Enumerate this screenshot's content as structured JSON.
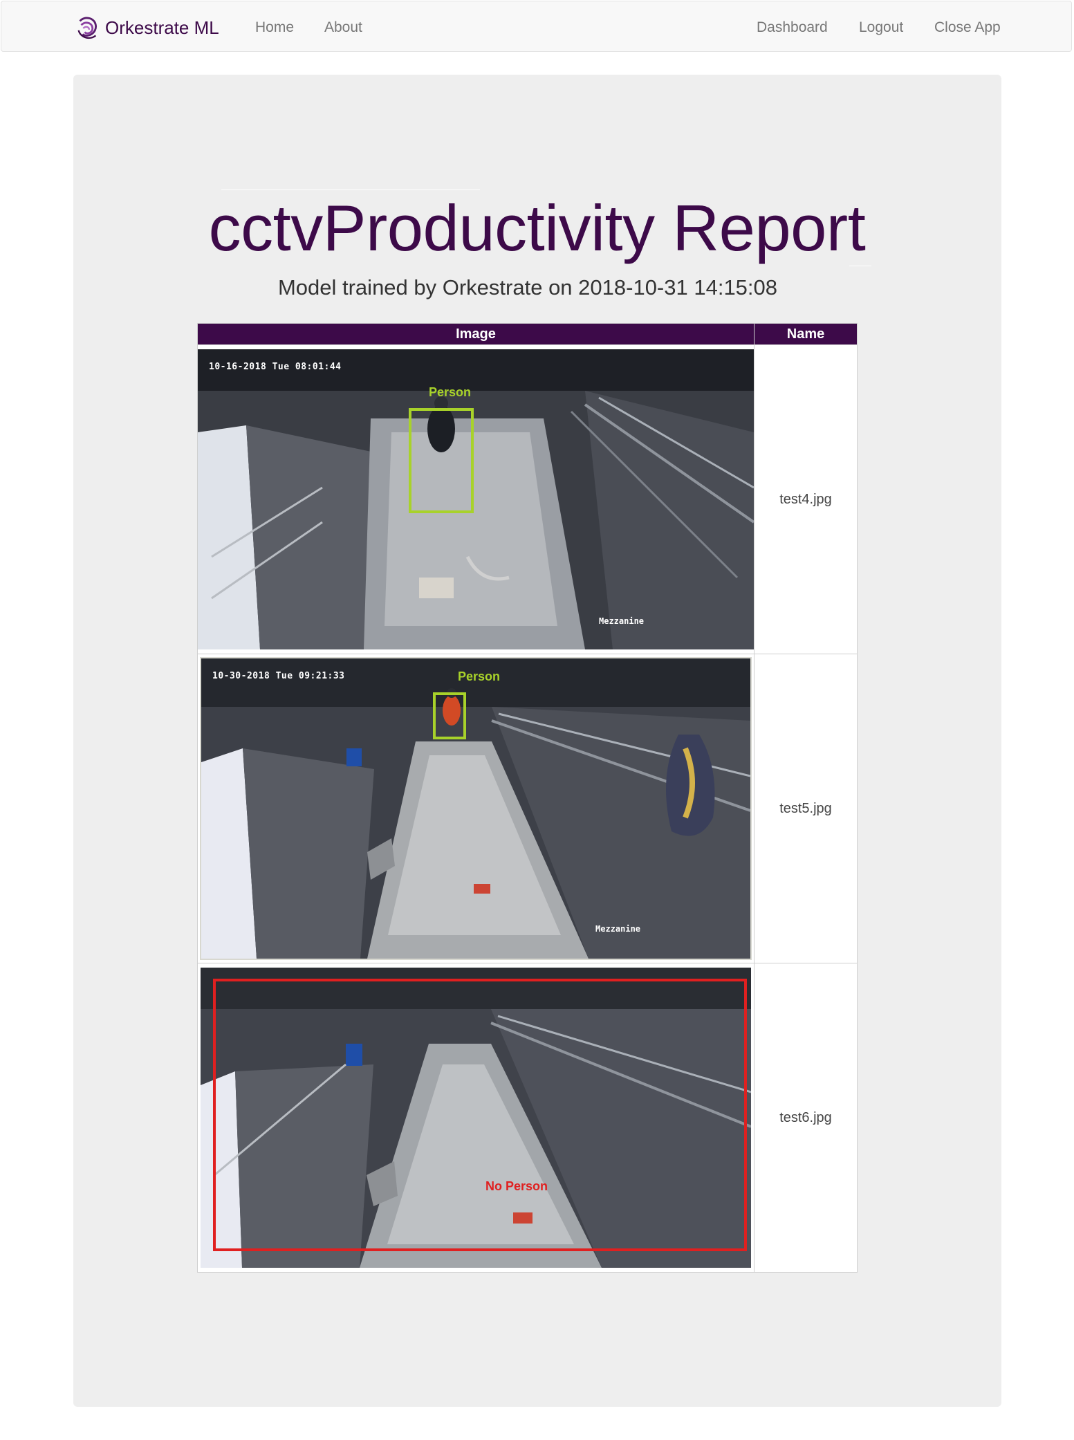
{
  "navbar": {
    "brand": "Orkestrate ML",
    "left_links": [
      "Home",
      "About"
    ],
    "right_links": [
      "Dashboard",
      "Logout",
      "Close App"
    ],
    "logo_icon": "orkestrate-swirl-logo"
  },
  "report": {
    "title": "cctvProductivity Report",
    "subtitle": "Model trained by Orkestrate on 2018-10-31 14:15:08"
  },
  "table": {
    "headers": [
      "Image",
      "Name"
    ],
    "rows": [
      {
        "name": "test4.jpg",
        "timestamp": "10-16-2018 Tue 08:01:44",
        "camera_label": "Mezzanine",
        "detection_label": "Person",
        "detection_color": "#a8d22a"
      },
      {
        "name": "test5.jpg",
        "timestamp": "10-30-2018 Tue 09:21:33",
        "camera_label": "Mezzanine",
        "detection_label": "Person",
        "detection_color": "#a8d22a"
      },
      {
        "name": "test6.jpg",
        "timestamp": "",
        "camera_label": "",
        "detection_label": "No Person",
        "detection_color": "#e02020"
      }
    ]
  },
  "colors": {
    "brand_purple": "#3d0a49",
    "jumbotron_bg": "#eeeeee",
    "navbar_bg": "#f8f8f8"
  }
}
